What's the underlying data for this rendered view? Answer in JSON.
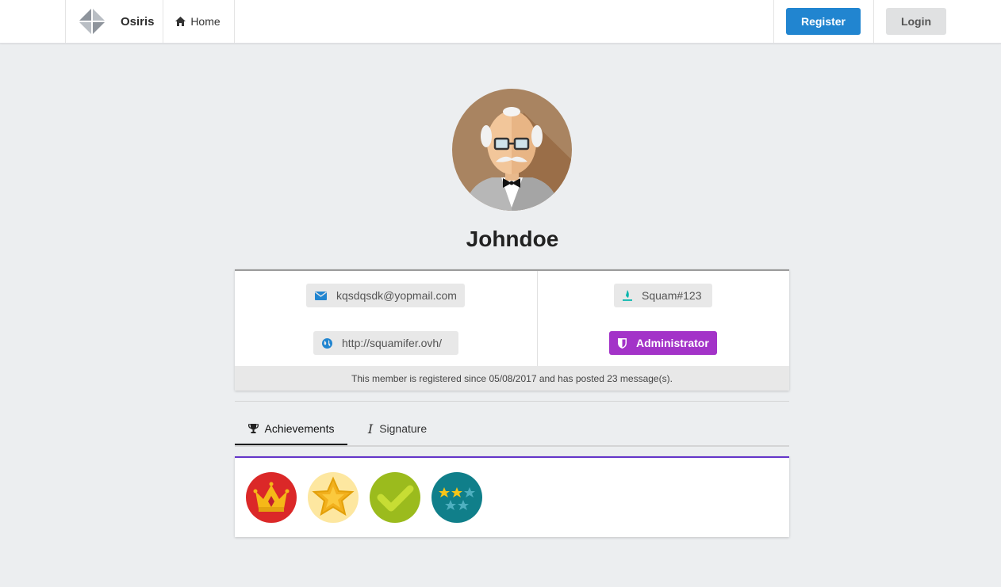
{
  "header": {
    "brand_name": "Osiris",
    "home_label": "Home",
    "register_label": "Register",
    "login_label": "Login",
    "icons": [
      "osiris-logo",
      "home-icon"
    ]
  },
  "profile": {
    "username": "Johndoe",
    "email": "kqsdqsdk@yopmail.com",
    "website": "http://squamifer.ovh/",
    "steam": "Squam#123",
    "role": "Administrator",
    "role_color": "#a333c8",
    "footer_text": "This member is registered since 05/08/2017 and has posted 23 message(s)."
  },
  "tabs": [
    {
      "label": "Achievements",
      "icon": "trophy-icon",
      "active": true
    },
    {
      "label": "Signature",
      "icon": "italic-icon",
      "active": false
    }
  ],
  "achievements": [
    {
      "icon": "crown-badge-icon",
      "color": "#db2828"
    },
    {
      "icon": "star-badge-icon",
      "color": "#fde7a0"
    },
    {
      "icon": "check-badge-icon",
      "color": "#9bbb1d"
    },
    {
      "icon": "stars-badge-icon",
      "color": "#107f8a"
    }
  ],
  "colors": {
    "primary": "#2185d0",
    "accent": "#6435c9",
    "background": "#eceef0"
  }
}
